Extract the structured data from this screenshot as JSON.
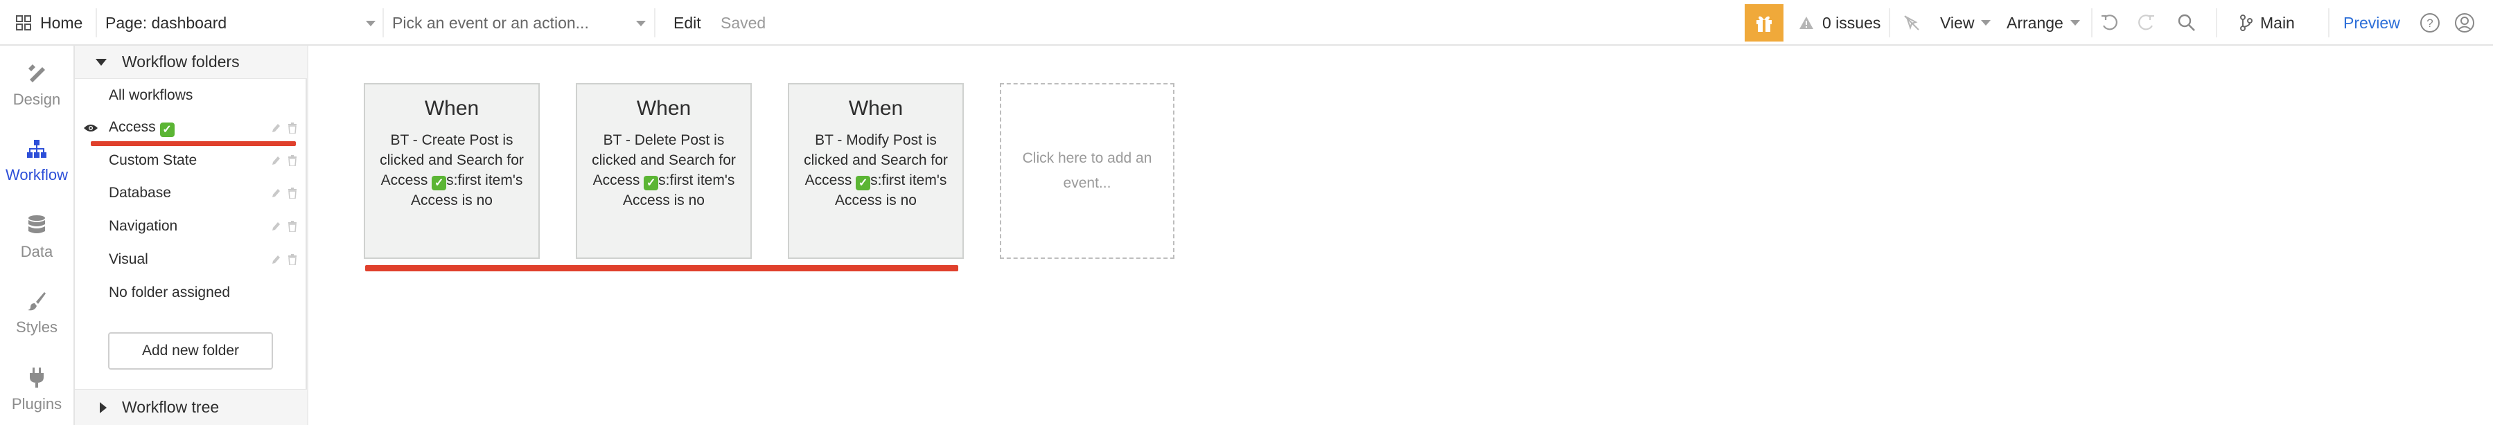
{
  "topbar": {
    "home_label": "Home",
    "page_select": "Page: dashboard",
    "event_select_placeholder": "Pick an event or an action...",
    "edit_label": "Edit",
    "saved_label": "Saved",
    "issues_label": "0 issues",
    "view_label": "View",
    "arrange_label": "Arrange",
    "branch_label": "Main",
    "preview_label": "Preview"
  },
  "rail": {
    "items": [
      {
        "label": "Design",
        "icon": "design-icon"
      },
      {
        "label": "Workflow",
        "icon": "workflow-icon"
      },
      {
        "label": "Data",
        "icon": "database-icon"
      },
      {
        "label": "Styles",
        "icon": "brush-icon"
      },
      {
        "label": "Plugins",
        "icon": "plug-icon"
      }
    ]
  },
  "panel": {
    "header": "Workflow folders",
    "folders": [
      {
        "label": "All workflows"
      },
      {
        "label": "Access",
        "badge": "✓"
      },
      {
        "label": "Custom State"
      },
      {
        "label": "Database"
      },
      {
        "label": "Navigation"
      },
      {
        "label": "Visual"
      },
      {
        "label": "No folder assigned"
      }
    ],
    "add_folder_label": "Add new folder",
    "footer": "Workflow tree"
  },
  "events": [
    {
      "when": "When",
      "desc_before": "BT - Create Post is clicked and Search for Access ",
      "desc_after": "s:first item's Access is no"
    },
    {
      "when": "When",
      "desc_before": "BT - Delete Post is clicked and Search for Access ",
      "desc_after": "s:first item's Access is no"
    },
    {
      "when": "When",
      "desc_before": "BT - Modify Post is clicked and Search for Access ",
      "desc_after": "s:first item's Access is no"
    }
  ],
  "add_event_label": "Click here to add an event...",
  "colors": {
    "accent_blue": "#2d4fd8",
    "gift_bg": "#f0a93a",
    "highlight_red": "#e0402c",
    "check_green": "#5bb534"
  }
}
